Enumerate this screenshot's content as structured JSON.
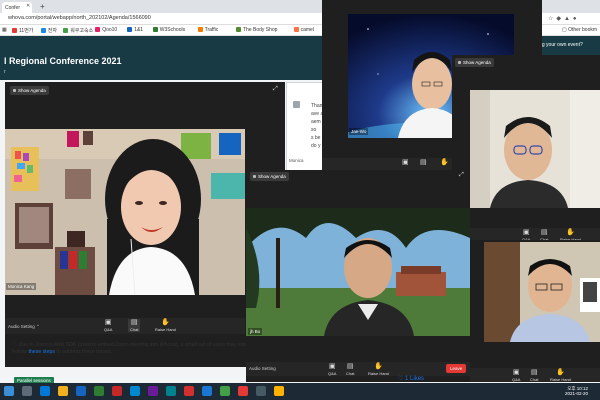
{
  "browser": {
    "tab_label": "Confer",
    "url": "whova.com/portal/webapp/north_202102/Agenda/1566090",
    "bookmarks": [
      {
        "label": "11번가",
        "color": "#e53935"
      },
      {
        "label": "전자",
        "color": "#1e88e5"
      },
      {
        "label": "워쿠고숙소",
        "color": "#43a047"
      },
      {
        "label": "Qoo10",
        "color": "#e91e63"
      },
      {
        "label": "1&1",
        "color": "#1565c0"
      },
      {
        "label": "W3Schools",
        "color": "#2e7d32"
      },
      {
        "label": "Traffic",
        "color": "#f57c00"
      },
      {
        "label": "The Body Shop",
        "color": "#558b2f"
      },
      {
        "label": "camel",
        "color": "#ff7043"
      },
      {
        "label": "한국",
        "color": "#3949ab"
      }
    ],
    "other_bookmarks": "Other bookm"
  },
  "page": {
    "title": "l Regional Conference 2021",
    "subtitle": "r",
    "side_link": "ing your own event?",
    "notice_text": "Due to Zoom's Web SDK (used to embed Zoom meeting into Whova), a small set of users may exp",
    "notice_text2": "Follow ",
    "notice_link": "these steps",
    "notice_text3": " to address these issues.",
    "parallel_label": "Parallel sessions",
    "likes": "1 Likes"
  },
  "zoom": {
    "show_agenda": "Show Agenda",
    "audio_setting": "Audio Setting",
    "qa": "Q&A",
    "chat": "Chat",
    "raise_hand": "Raise Hand",
    "leave": "Leave",
    "participants": {
      "main": "Monica Kang",
      "top_right": "Jae-Wo",
      "center": "jh Bo"
    }
  },
  "chat_panel": {
    "lines": [
      "Than",
      "ave a",
      "aem",
      "so",
      "s be",
      "do y"
    ],
    "sender": "Monica"
  },
  "colors": {
    "header": "#173a44",
    "leave": "#e53935",
    "link": "#1a73e8",
    "parallel_badge": "#1e7d4f"
  },
  "taskbar": {
    "time": "오후 10:12",
    "date": "2021-02-20"
  }
}
